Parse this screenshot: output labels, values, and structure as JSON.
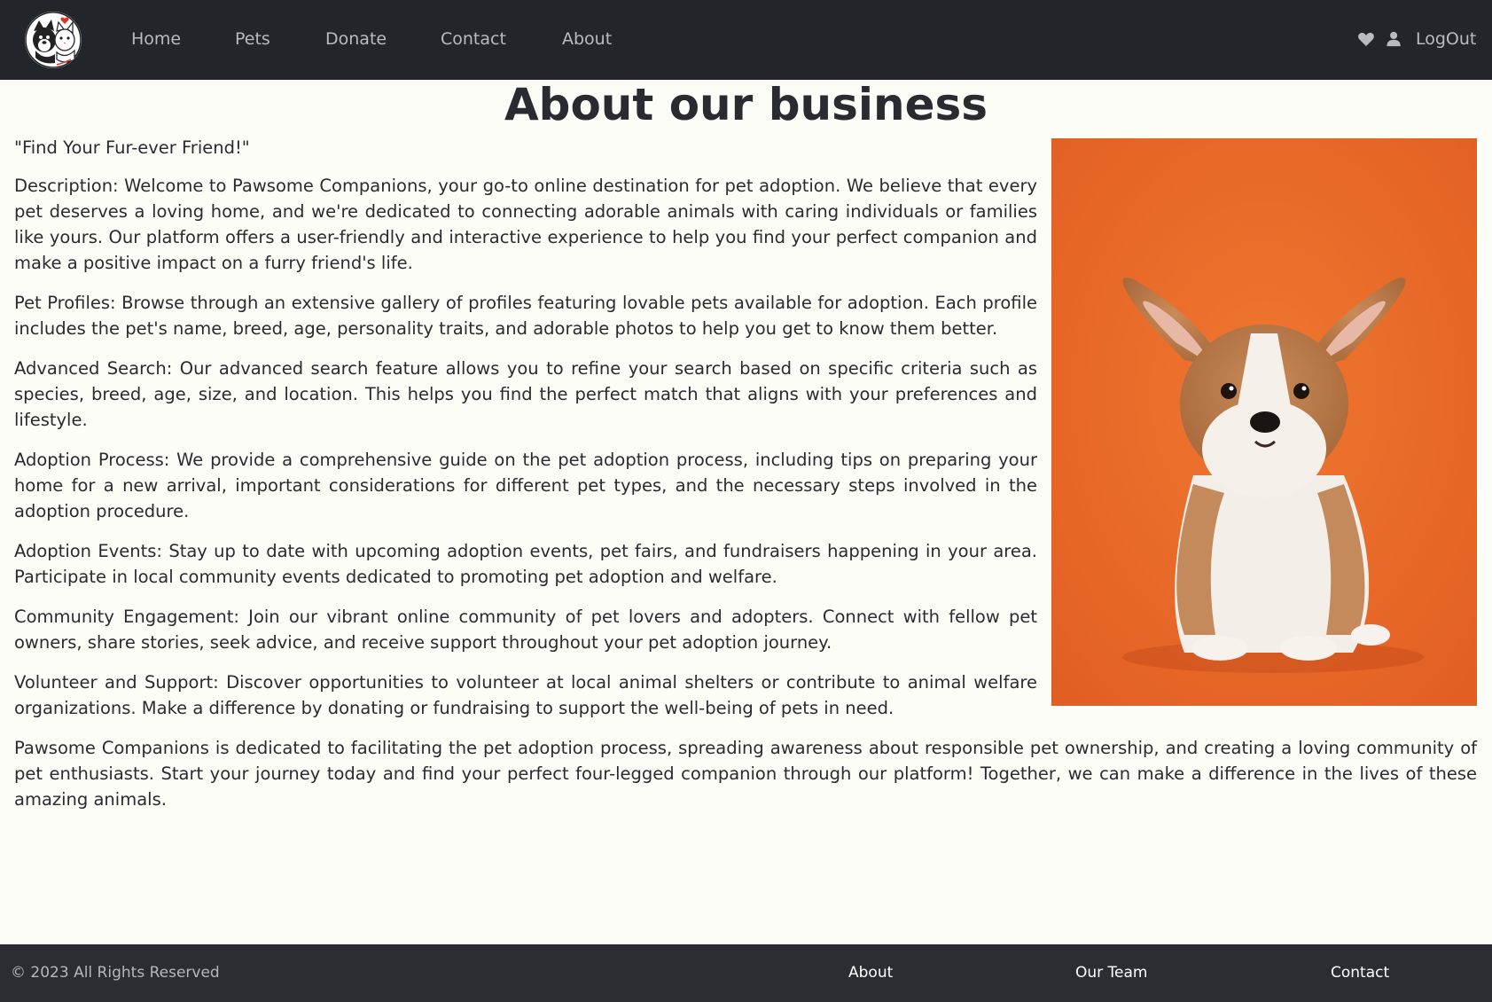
{
  "nav": {
    "logo_icon": "cat-and-dog-logo-icon",
    "links": [
      "Home",
      "Pets",
      "Donate",
      "Contact",
      "About"
    ],
    "favorites_icon": "heart-icon",
    "user_icon": "user-icon",
    "logout_label": "LogOut"
  },
  "main": {
    "title": "About our business",
    "tagline": "\"Find Your Fur-ever Friend!\"",
    "paragraphs": [
      "Description: Welcome to Pawsome Companions, your go-to online destination for pet adoption. We believe that every pet deserves a loving home, and we're dedicated to connecting adorable animals with caring individuals or families like yours. Our platform offers a user-friendly and interactive experience to help you find your perfect companion and make a positive impact on a furry friend's life.",
      "Pet Profiles: Browse through an extensive gallery of profiles featuring lovable pets available for adoption. Each profile includes the pet's name, breed, age, personality traits, and adorable photos to help you get to know them better.",
      "Advanced Search: Our advanced search feature allows you to refine your search based on specific criteria such as species, breed, age, size, and location. This helps you find the perfect match that aligns with your preferences and lifestyle.",
      "Adoption Process: We provide a comprehensive guide on the pet adoption process, including tips on preparing your home for a new arrival, important considerations for different pet types, and the necessary steps involved in the adoption procedure.",
      "Adoption Events: Stay up to date with upcoming adoption events, pet fairs, and fundraisers happening in your area. Participate in local community events dedicated to promoting pet adoption and welfare.",
      "Community Engagement: Join our vibrant online community of pet lovers and adopters. Connect with fellow pet owners, share stories, seek advice, and receive support throughout your pet adoption journey.",
      "Volunteer and Support: Discover opportunities to volunteer at local animal shelters or contribute to animal welfare organizations. Make a difference by donating or fundraising to support the well-being of pets in need."
    ],
    "closing": "Pawsome Companions is dedicated to facilitating the pet adoption process, spreading awareness about responsible pet ownership, and creating a loving community of pet enthusiasts. Start your journey today and find your perfect four-legged companion through our platform! Together, we can make a difference in the lives of these amazing animals.",
    "image": "corgi-puppy-on-orange-background"
  },
  "footer": {
    "copyright": "© 2023 All Rights Reserved",
    "links": [
      "About",
      "Our Team",
      "Contact"
    ]
  },
  "colors": {
    "navbar": "#22262b",
    "footer": "#2c2d33",
    "page_background": "#fdfdf7",
    "photo_background": "#e8692c"
  }
}
